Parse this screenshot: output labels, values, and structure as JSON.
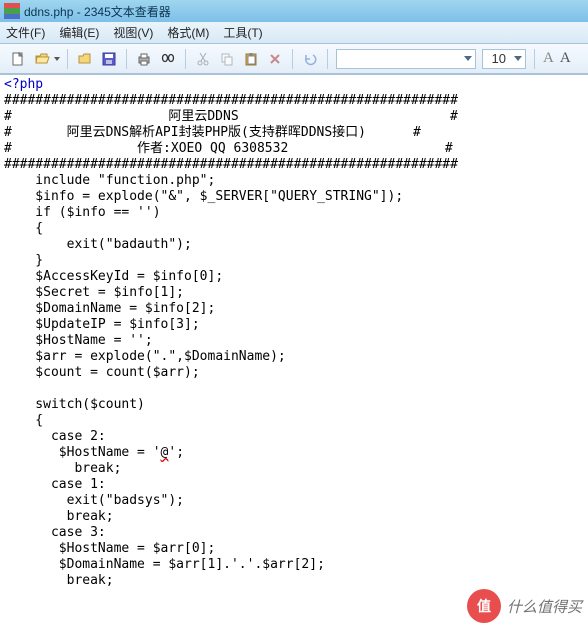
{
  "window": {
    "title": "ddns.php - 2345文本查看器"
  },
  "menu": [
    {
      "label": "文件(F)"
    },
    {
      "label": "编辑(E)"
    },
    {
      "label": "视图(V)"
    },
    {
      "label": "格式(M)"
    },
    {
      "label": "工具(T)"
    }
  ],
  "toolbar": {
    "font_combo": "",
    "size_combo": "10",
    "A1": "A",
    "A2": "A"
  },
  "code": {
    "php_open": "<?php",
    "lines": [
      "##########################################################",
      "#                    阿里云DDNS                           #",
      "#       阿里云DNS解析API封装PHP版(支持群晖DDNS接口)      #",
      "#                作者:XOEO QQ 6308532                    #",
      "##########################################################",
      "    include \"function.php\";",
      "    $info = explode(\"&\", $_SERVER[\"QUERY_STRING\"]);",
      "    if ($info == '')",
      "    {",
      "        exit(\"badauth\");",
      "    }",
      "    $AccessKeyId = $info[0];",
      "    $Secret = $info[1];",
      "    $DomainName = $info[2];",
      "    $UpdateIP = $info[3];",
      "    $HostName = '';",
      "    $arr = explode(\".\",$DomainName);",
      "    $count = count($arr);",
      "",
      "    switch($count)",
      "    {",
      "      case 2:"
    ],
    "host_at_prefix": "       $HostName = '",
    "host_at_char": "@",
    "host_at_suffix": "';",
    "lines2": [
      "         break;",
      "      case 1:",
      "        exit(\"badsys\");",
      "        break;",
      "      case 3:",
      "       $HostName = $arr[0];",
      "       $DomainName = $arr[1].'.'.$arr[2];",
      "        break;"
    ]
  },
  "watermark": {
    "badge": "值",
    "text": "什么值得买"
  }
}
